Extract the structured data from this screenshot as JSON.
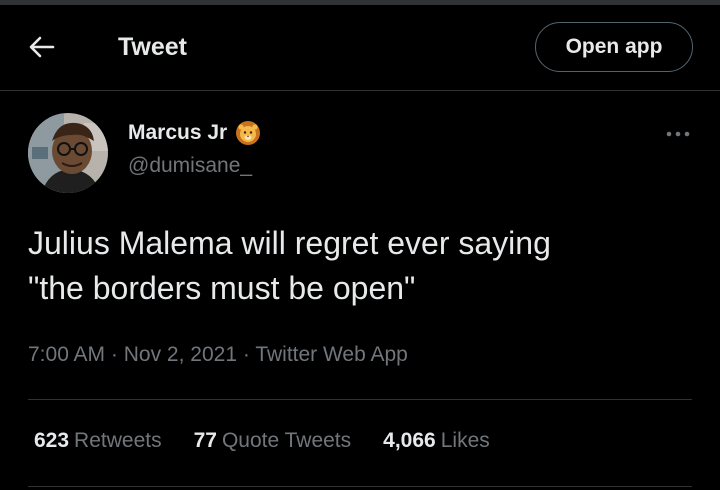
{
  "header": {
    "back_icon": "arrow-left-icon",
    "title": "Tweet",
    "open_app_label": "Open app"
  },
  "tweet": {
    "author": {
      "name": "Marcus Jr",
      "badge_icon": "lion-emoji-icon",
      "handle": "@dumisane_"
    },
    "more_icon": "more-horizontal-icon",
    "text": "Julius Malema will regret ever saying\n\"the borders must be open\"",
    "time": "7:00 AM",
    "separator": "·",
    "date": "Nov 2, 2021",
    "source": "Twitter Web App"
  },
  "stats": {
    "retweets_count": "623",
    "retweets_label": "Retweets",
    "quotes_count": "77",
    "quotes_label": "Quote Tweets",
    "likes_count": "4,066",
    "likes_label": "Likes"
  },
  "colors": {
    "background": "#000000",
    "primary_text": "#e7e9ea",
    "secondary_text": "#71767b",
    "border": "#2f3336"
  }
}
